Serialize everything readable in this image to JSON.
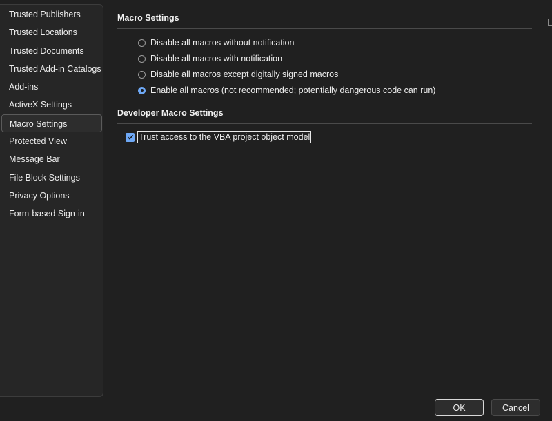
{
  "sidebar": {
    "items": [
      {
        "label": "Trusted Publishers"
      },
      {
        "label": "Trusted Locations"
      },
      {
        "label": "Trusted Documents"
      },
      {
        "label": "Trusted Add-in Catalogs"
      },
      {
        "label": "Add-ins"
      },
      {
        "label": "ActiveX Settings"
      },
      {
        "label": "Macro Settings"
      },
      {
        "label": "Protected View"
      },
      {
        "label": "Message Bar"
      },
      {
        "label": "File Block Settings"
      },
      {
        "label": "Privacy Options"
      },
      {
        "label": "Form-based Sign-in"
      }
    ],
    "selected": "Macro Settings"
  },
  "macro_settings": {
    "title": "Macro Settings",
    "options": [
      {
        "label": "Disable all macros without notification",
        "checked": false
      },
      {
        "label": "Disable all macros with notification",
        "checked": false
      },
      {
        "label": "Disable all macros except digitally signed macros",
        "checked": false
      },
      {
        "label": "Enable all macros (not recommended; potentially dangerous code can run)",
        "checked": true
      }
    ]
  },
  "developer_settings": {
    "title": "Developer Macro Settings",
    "vba_trust_label": "Trust access to the VBA project object model",
    "vba_trust_checked": true
  },
  "buttons": {
    "ok": "OK",
    "cancel": "Cancel"
  },
  "colors": {
    "background": "#202020",
    "accent": "#6ea8f5"
  }
}
